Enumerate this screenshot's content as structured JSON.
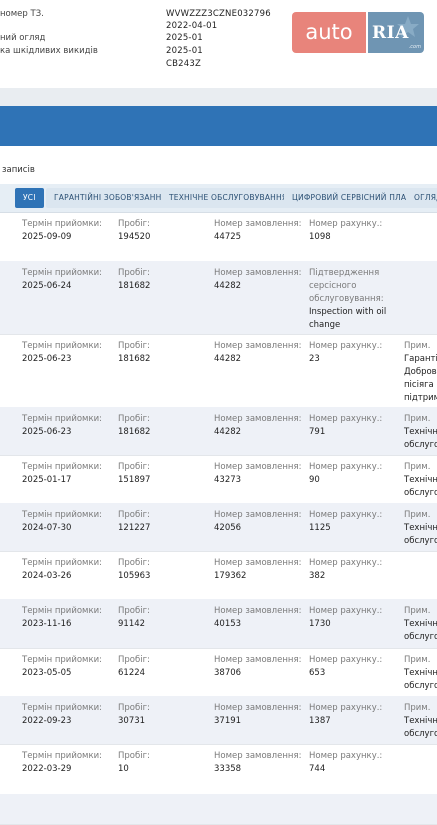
{
  "top_labels": [
    "номер ТЗ.",
    "ний огляд",
    "ка шкідливих викидів"
  ],
  "top_values": [
    "WVWZZZ3CZNE032796",
    "2022-04-01",
    "2025-01",
    "2025-01",
    "CB243Z"
  ],
  "logo": {
    "left": "auto",
    "right": "RIA",
    "suffix": ".com"
  },
  "records_label": "записів",
  "tabs": [
    "УСІ",
    "ГАРАНТІЙНІ ЗОБОВ'ЯЗАННЯ",
    "ТЕХНІЧНЕ ОБСЛУГОВУВАННЯ",
    "ЦИФРОВИЙ СЕРВІСНИЙ ПЛАН",
    "ОГЛЯД"
  ],
  "field_labels": {
    "date": "Термін прийомки:",
    "mileage": "Пробіг:",
    "order": "Номер замовлення:",
    "invoice": "Номер рахунку.:",
    "note": "Прим."
  },
  "records": [
    {
      "date": "2025-09-09",
      "mileage": "194520",
      "order": "44725",
      "invoice": "1098",
      "note": ""
    },
    {
      "date": "2025-06-24",
      "mileage": "181682",
      "order": "44282",
      "invoice_label_override": "Підтвердження серсісного обслуговування:",
      "invoice": "Inspection with oil change",
      "note": ""
    },
    {
      "date": "2025-06-23",
      "mileage": "181682",
      "order": "44282",
      "invoice": "23",
      "note": "Гаранті Добров пісіяга підтрим"
    },
    {
      "date": "2025-06-23",
      "mileage": "181682",
      "order": "44282",
      "invoice": "791",
      "note": "Технічн обслуго"
    },
    {
      "date": "2025-01-17",
      "mileage": "151897",
      "order": "43273",
      "invoice": "90",
      "note": "Технічн обслуго"
    },
    {
      "date": "2024-07-30",
      "mileage": "121227",
      "order": "42056",
      "invoice": "1125",
      "note": "Технічн обслуго"
    },
    {
      "date": "2024-03-26",
      "mileage": "105963",
      "order": "179362",
      "invoice": "382",
      "note": ""
    },
    {
      "date": "2023-11-16",
      "mileage": "91142",
      "order": "40153",
      "invoice": "1730",
      "note": "Технічн обслуго"
    },
    {
      "date": "2023-05-05",
      "mileage": "61224",
      "order": "38706",
      "invoice": "653",
      "note": "Технічн обслуго"
    },
    {
      "date": "2022-09-23",
      "mileage": "30731",
      "order": "37191",
      "invoice": "1387",
      "note": "Технічн обслуго"
    },
    {
      "date": "2022-03-29",
      "mileage": "10",
      "order": "33358",
      "invoice": "744",
      "note": ""
    }
  ],
  "colors": {
    "blue": "#2f73b6",
    "shade": "#eef1f7",
    "auto": "#e8847b",
    "ria": "#6f95b3"
  }
}
